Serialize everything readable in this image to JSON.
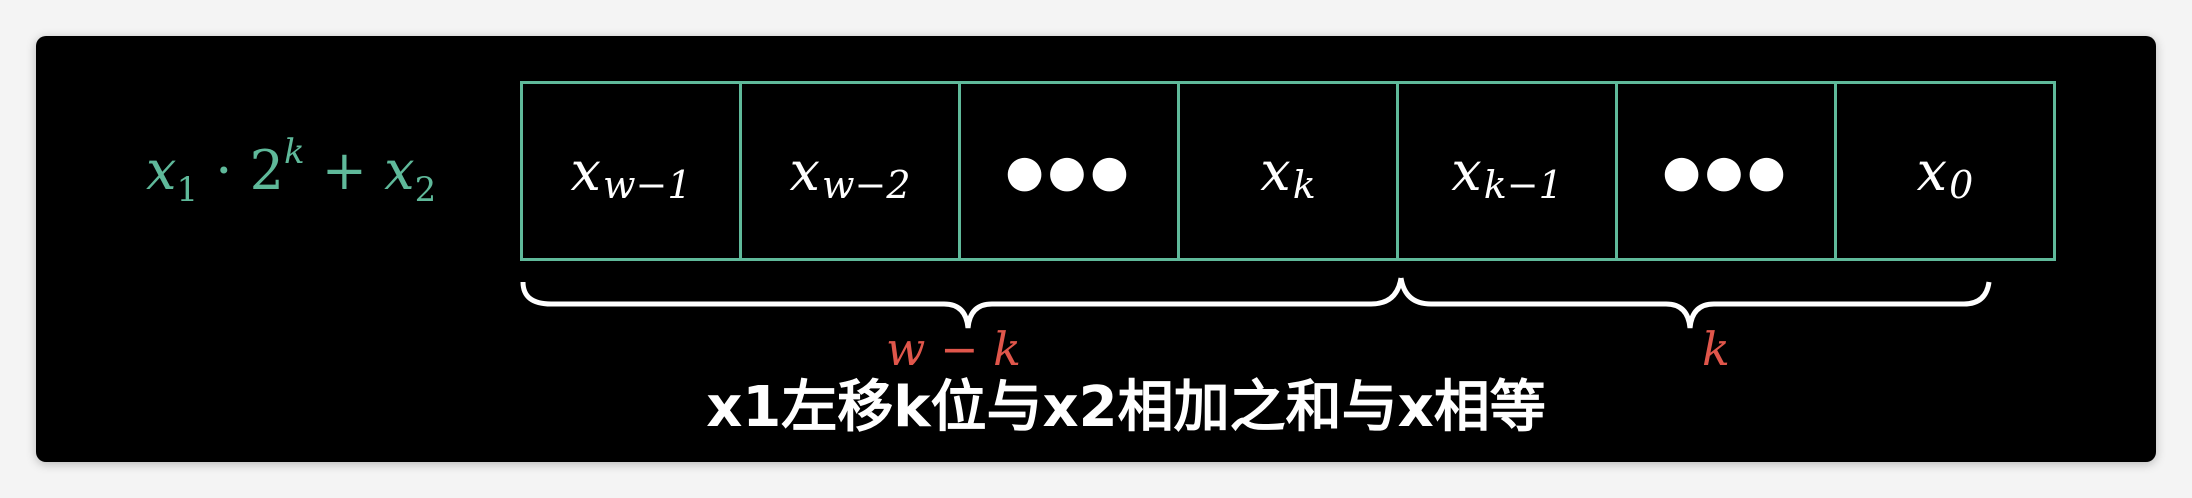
{
  "formula": {
    "x": "x",
    "sub1": "1",
    "dot": " · ",
    "base": "2",
    "exp": "k",
    "plus": " + ",
    "x2": "x",
    "sub2": "2"
  },
  "cells": [
    {
      "main": "x",
      "sub": "w−1"
    },
    {
      "main": "x",
      "sub": "w−2"
    },
    {
      "dots": "●●●"
    },
    {
      "main": "x",
      "sub": "k"
    },
    {
      "main": "x",
      "sub": "k−1"
    },
    {
      "dots": "●●●"
    },
    {
      "main": "x",
      "sub": "0"
    }
  ],
  "braces": {
    "left_label": "w − k",
    "right_label": "k"
  },
  "caption": "x1左移k位与x2相加之和与x相等",
  "colors": {
    "teal": "#5fb99a",
    "red": "#e0564b",
    "white": "#ffffff",
    "background": "#000000"
  }
}
